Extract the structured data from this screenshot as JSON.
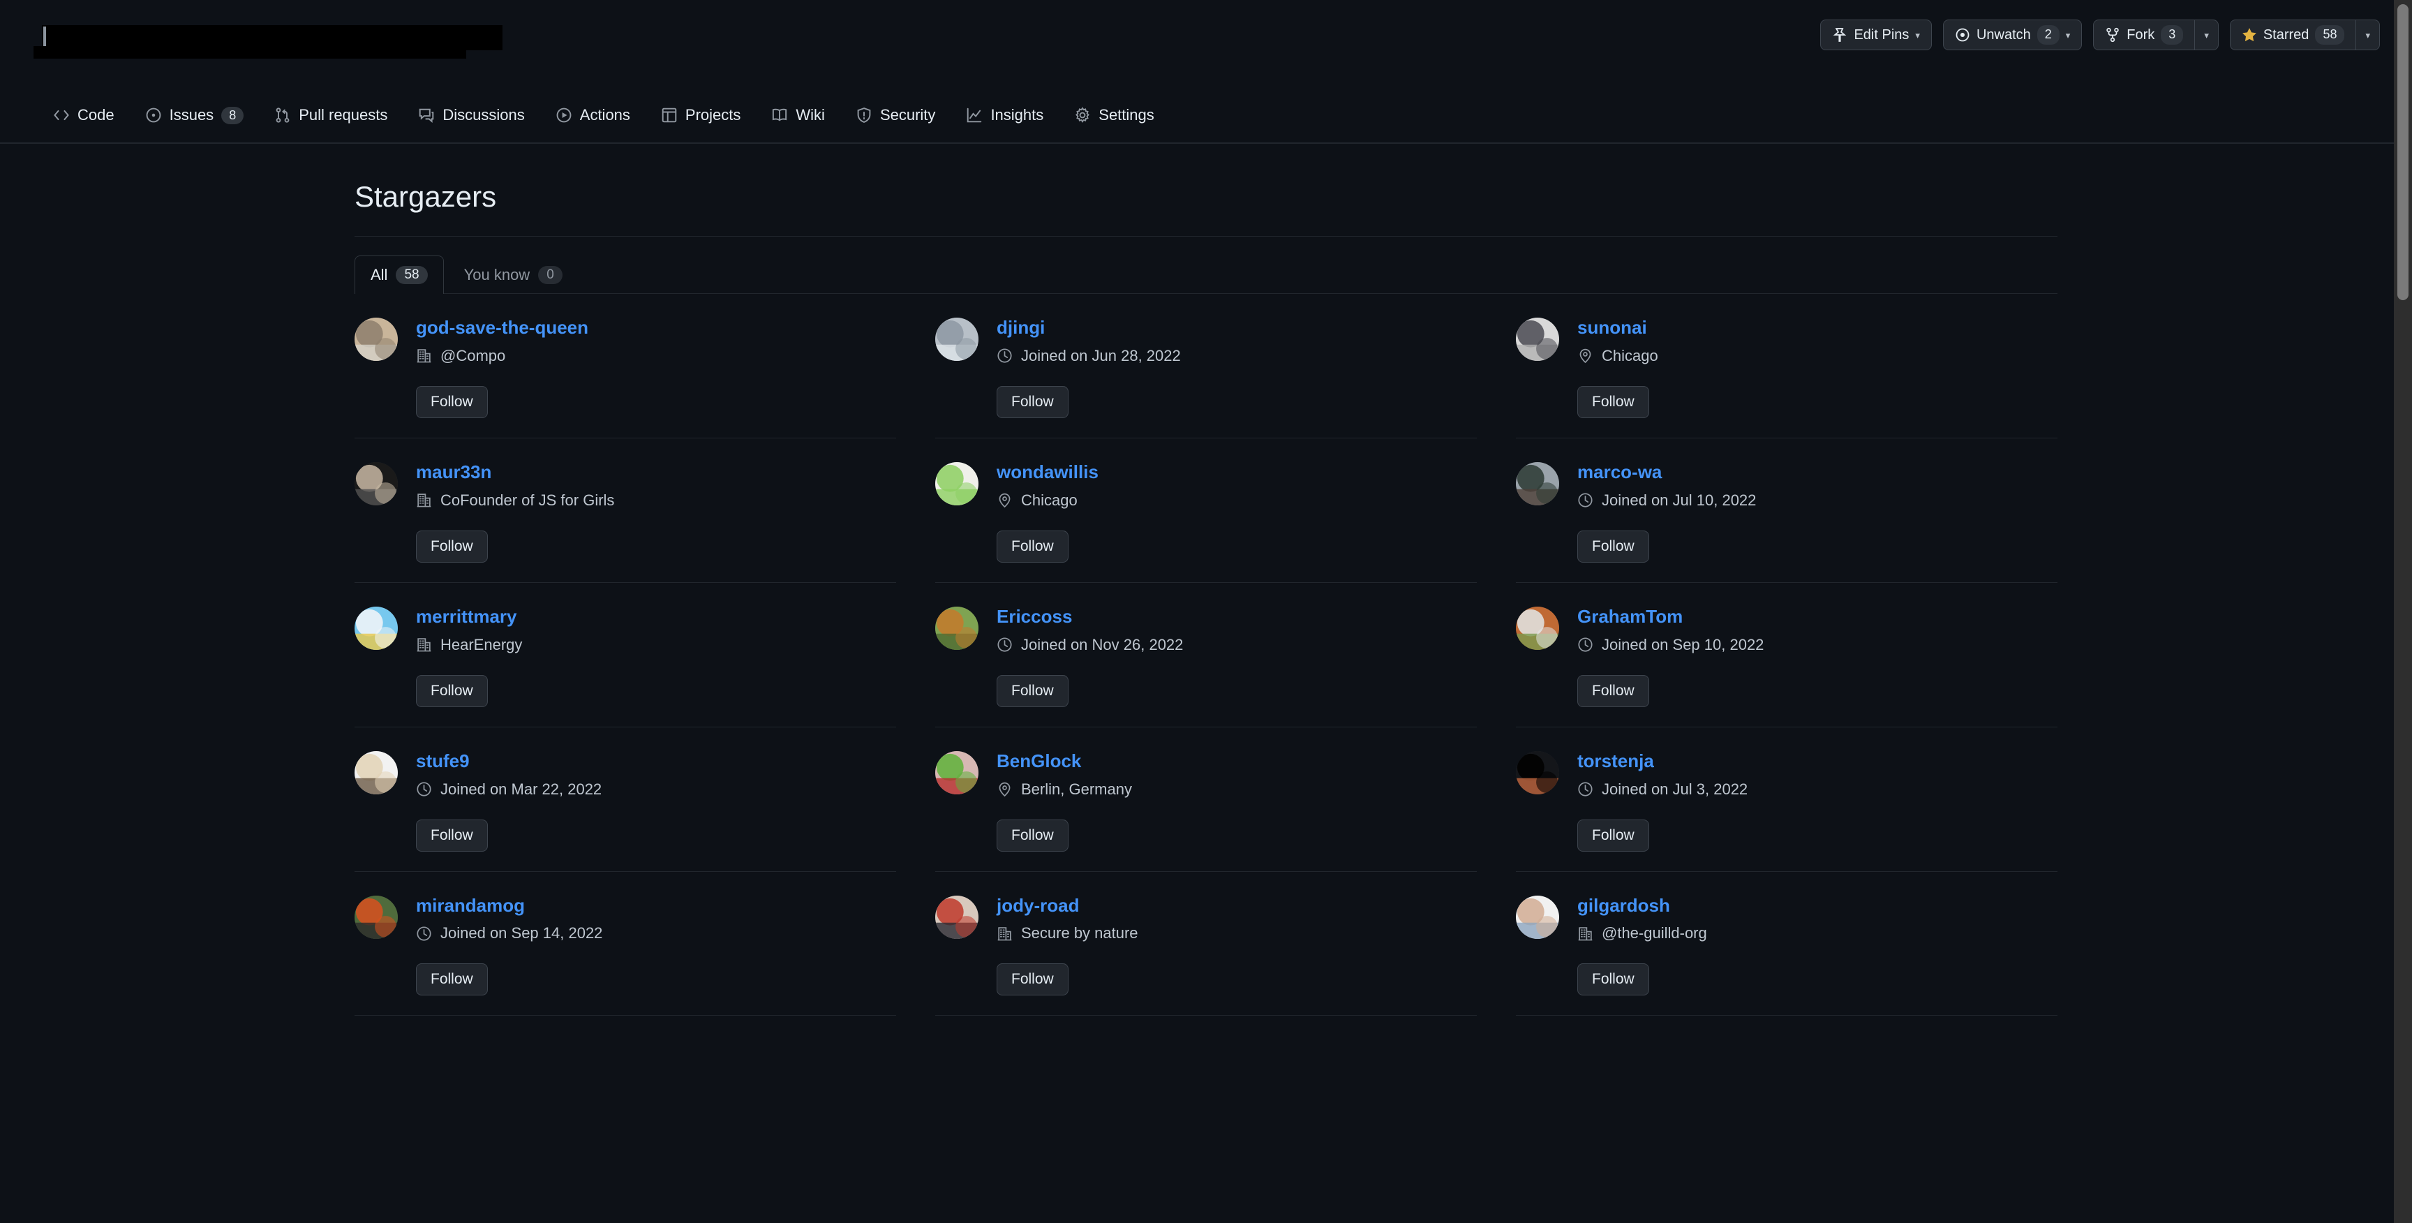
{
  "header": {
    "repo_name_redacted": "",
    "actions": [
      {
        "name": "edit-pins",
        "icon": "pin-icon",
        "label": "Edit Pins",
        "count": null,
        "caret": true,
        "split": false
      },
      {
        "name": "unwatch",
        "icon": "eye-icon",
        "label": "Unwatch",
        "count": "2",
        "caret": true,
        "split": false
      },
      {
        "name": "fork",
        "icon": "fork-icon",
        "label": "Fork",
        "count": "3",
        "caret": true,
        "split": true
      },
      {
        "name": "starred",
        "icon": "star-icon",
        "label": "Starred",
        "count": "58",
        "caret": true,
        "split": true
      }
    ]
  },
  "nav": {
    "items": [
      {
        "label": "Code",
        "icon": "code-icon",
        "count": null
      },
      {
        "label": "Issues",
        "icon": "issue-opened-icon",
        "count": "8"
      },
      {
        "label": "Pull requests",
        "icon": "git-pull-request-icon",
        "count": null
      },
      {
        "label": "Discussions",
        "icon": "comment-discussion-icon",
        "count": null
      },
      {
        "label": "Actions",
        "icon": "play-icon",
        "count": null
      },
      {
        "label": "Projects",
        "icon": "table-icon",
        "count": null
      },
      {
        "label": "Wiki",
        "icon": "book-icon",
        "count": null
      },
      {
        "label": "Security",
        "icon": "shield-icon",
        "count": null
      },
      {
        "label": "Insights",
        "icon": "graph-icon",
        "count": null
      },
      {
        "label": "Settings",
        "icon": "gear-icon",
        "count": null
      }
    ]
  },
  "main": {
    "title": "Stargazers",
    "tabs": [
      {
        "label": "All",
        "count": "58",
        "active": true
      },
      {
        "label": "You know",
        "count": "0",
        "active": false
      }
    ],
    "follow_label": "Follow",
    "stargazers": [
      {
        "username": "god-save-the-queen",
        "meta_icon": "organization-icon",
        "meta": "@Compo",
        "avatar": "city-street",
        "colors": [
          "#c9b59a",
          "#8e7f6d",
          "#d6d2c8"
        ]
      },
      {
        "username": "djingi",
        "meta_icon": "clock-icon",
        "meta": "Joined on Jun 28, 2022",
        "avatar": "sculpture",
        "colors": [
          "#b8c0c8",
          "#8d98a3",
          "#dde3e8"
        ]
      },
      {
        "username": "sunonai",
        "meta_icon": "location-icon",
        "meta": "Chicago",
        "avatar": "man-suit",
        "colors": [
          "#d9d9d9",
          "#4a4a52",
          "#b1b1b1"
        ]
      },
      {
        "username": "maur33n",
        "meta_icon": "organization-icon",
        "meta": "CoFounder of JS for Girls",
        "avatar": "bw-portrait",
        "colors": [
          "#1a1a1a",
          "#c9b9a4",
          "#515151"
        ]
      },
      {
        "username": "wondawillis",
        "meta_icon": "location-icon",
        "meta": "Chicago",
        "avatar": "green-logo",
        "colors": [
          "#f0f0ea",
          "#8dcf62",
          "#8dcf62"
        ]
      },
      {
        "username": "marco-wa",
        "meta_icon": "clock-icon",
        "meta": "Joined on Jul 10, 2022",
        "avatar": "photographer",
        "colors": [
          "#9aa3ab",
          "#2b3a33",
          "#4d4038"
        ]
      },
      {
        "username": "merrittmary",
        "meta_icon": "organization-icon",
        "meta": "HearEnergy",
        "avatar": "unicorn-float",
        "colors": [
          "#77c8ee",
          "#f4f6f8",
          "#e9c84a"
        ]
      },
      {
        "username": "Ericcoss",
        "meta_icon": "clock-icon",
        "meta": "Joined on Nov 26, 2022",
        "avatar": "golden-dog",
        "colors": [
          "#7fa352",
          "#c47a2b",
          "#4f6a32"
        ]
      },
      {
        "username": "GrahamTom",
        "meta_icon": "clock-icon",
        "meta": "Joined on Sep 10, 2022",
        "avatar": "autumn-lake",
        "colors": [
          "#c06a34",
          "#e2e6e8",
          "#7a9a4e"
        ]
      },
      {
        "username": "stufe9",
        "meta_icon": "clock-icon",
        "meta": "Joined on Mar 22, 2022",
        "avatar": "doll-sticker",
        "colors": [
          "#f2f2f2",
          "#e3d4b6",
          "#6b5a46"
        ]
      },
      {
        "username": "BenGlock",
        "meta_icon": "location-icon",
        "meta": "Berlin, Germany",
        "avatar": "green-parrot",
        "colors": [
          "#d7b8b4",
          "#5fb13a",
          "#b83030"
        ]
      },
      {
        "username": "torstenja",
        "meta_icon": "clock-icon",
        "meta": "Joined on Jul 3, 2022",
        "avatar": "man-sunglasses",
        "colors": [
          "#14161a",
          "#b1apage",
          "#c1663f"
        ]
      },
      {
        "username": "mirandamog",
        "meta_icon": "clock-icon",
        "meta": "Joined on Sep 14, 2022",
        "avatar": "orange-car",
        "colors": [
          "#4f6b3c",
          "#d8501e",
          "#2b2b2b"
        ]
      },
      {
        "username": "jody-road",
        "meta_icon": "organization-icon",
        "meta": "Secure by nature",
        "avatar": "woman-stairs",
        "colors": [
          "#d8c9bd",
          "#c0392b",
          "#2b2b33"
        ]
      },
      {
        "username": "gilgardosh",
        "meta_icon": "organization-icon",
        "meta": "@the-guilld-org",
        "avatar": "man-portrait",
        "colors": [
          "#f1f1f1",
          "#d2ad94",
          "#8fa6c1"
        ]
      }
    ]
  },
  "scrollbar": {
    "visible": true
  }
}
